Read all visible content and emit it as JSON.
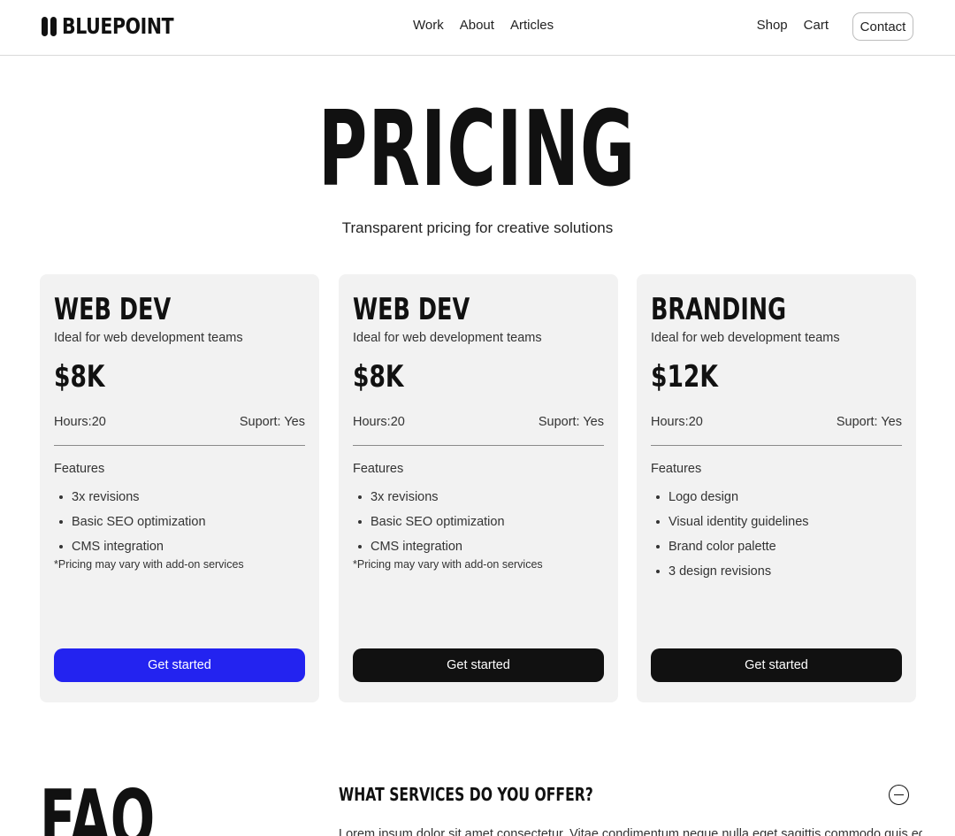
{
  "header": {
    "logo_text": "BLUEPOINT",
    "logo_icon": "double-pill-logo-mark",
    "nav_center": [
      "Work",
      "About",
      "Articles"
    ],
    "nav_right": [
      "Shop",
      "Cart"
    ],
    "contact_label": "Contact"
  },
  "hero": {
    "title": "PRICING",
    "subtitle": "Transparent pricing for creative solutions"
  },
  "cards": [
    {
      "title": "WEB DEV",
      "description": "Ideal for web development teams",
      "price": "$8K",
      "hours": "Hours:20",
      "support": "Suport: Yes",
      "features_label": "Features",
      "features": [
        "3x revisions",
        "Basic SEO optimization",
        "CMS integration"
      ],
      "note": "*Pricing may vary with add-on services",
      "button_label": "Get started",
      "button_color": "#2323f0"
    },
    {
      "title": "WEB DEV",
      "description": "Ideal for web development teams",
      "price": "$8K",
      "hours": "Hours:20",
      "support": "Suport: Yes",
      "features_label": "Features",
      "features": [
        "3x revisions",
        "Basic SEO optimization",
        "CMS integration"
      ],
      "note": "*Pricing may vary with add-on services",
      "button_label": "Get started",
      "button_color": "#111111"
    },
    {
      "title": "BRANDING",
      "description": "Ideal for web development teams",
      "price": "$12K",
      "hours": "Hours:20",
      "support": "Suport: Yes",
      "features_label": "Features",
      "features": [
        "Logo design",
        "Visual identity guidelines",
        "Brand color palette",
        "3 design revisions"
      ],
      "button_label": "Get started",
      "button_color": "#111111"
    }
  ],
  "faq": {
    "title": "FAQ",
    "question": "WHAT SERVICES DO YOU OFFER?",
    "toggle_icon": "minus-circle-icon",
    "answer": "Lorem ipsum dolor sit amet consectetur. Vitae condimentum neque nulla eget sagittis commodo quis eget et"
  },
  "colors": {
    "accent": "#2323f0",
    "card_background": "#f2f2f2",
    "text": "#111111"
  }
}
